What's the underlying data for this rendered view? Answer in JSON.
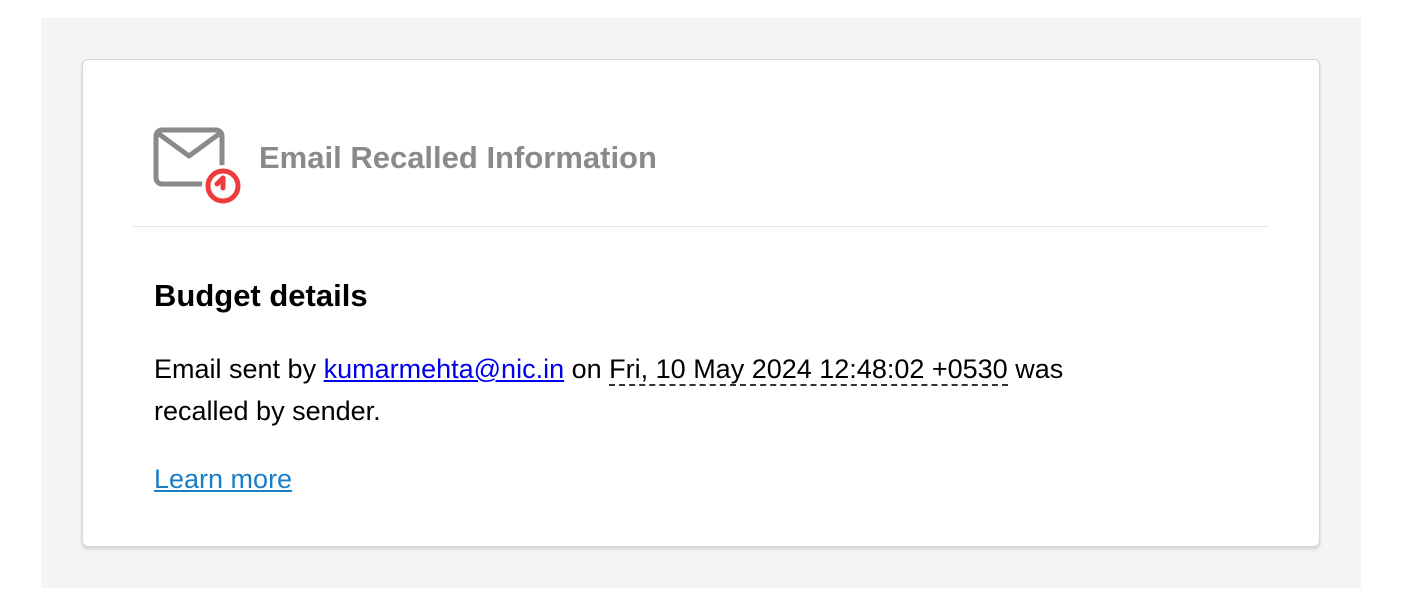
{
  "header": {
    "title": "Email Recalled Information",
    "icon": "email-recall-icon",
    "icon_gray": "#8a8a8a",
    "icon_accent": "#ef3b3b"
  },
  "message": {
    "subject": "Budget details",
    "prefix": "Email sent by",
    "sender": "kumarmehta@nic.in",
    "connector": "on",
    "datetime": "Fri, 10 May 2024 12:48:02 +0530",
    "suffix": "was recalled by sender."
  },
  "links": {
    "learn_more": "Learn more"
  },
  "colors": {
    "page_background": "#f4f4f4",
    "card_background": "#ffffff",
    "link": "#0000ee",
    "learn_more": "#1a7ec7"
  }
}
